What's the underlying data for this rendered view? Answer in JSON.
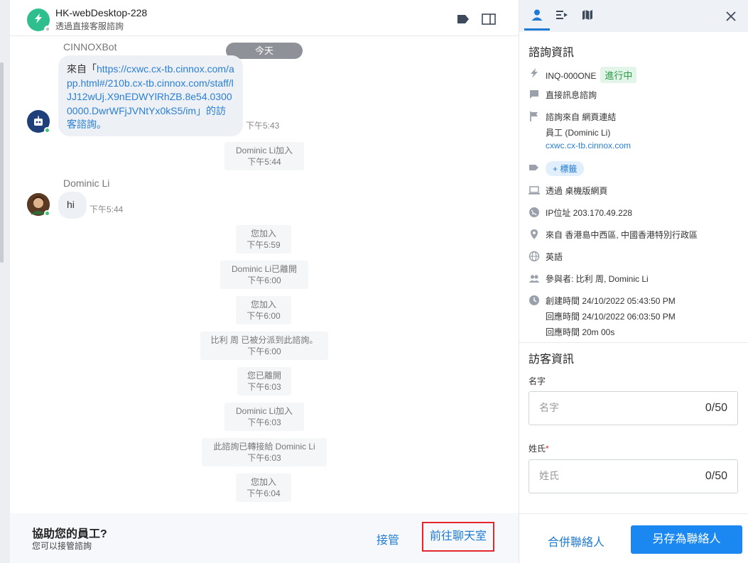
{
  "header": {
    "title": "HK-webDesktop-228",
    "subtitle": "透過直接客服諮詢"
  },
  "chat": {
    "date_pill": "今天",
    "messages": [
      {
        "sender": "CINNOXBot",
        "prefix": "來自「",
        "link": "https://cxwc.cx-tb.cinnox.com/app.html#/210b.cx-tb.cinnox.com/staff/lJJ12wUj.X9nEDWYlRhZB.8e54.03000000.DwrWFjJVNtYx0kS5/im",
        "suffix": "」的訪客諮詢。",
        "time": "下午5:43"
      },
      {
        "sender": "Dominic Li",
        "text": "hi",
        "time": "下午5:44"
      }
    ],
    "system": [
      {
        "text": "Dominic Li加入",
        "time": "下午5:44"
      },
      {
        "text": "您加入",
        "time": "下午5:59"
      },
      {
        "text": "Dominic Li已離開",
        "time": "下午6:00"
      },
      {
        "text": "您加入",
        "time": "下午6:00"
      },
      {
        "text": "比利 周 已被分派到此諮詢。",
        "time": "下午6:00"
      },
      {
        "text": "您已離開",
        "time": "下午6:03"
      },
      {
        "text": "Dominic Li加入",
        "time": "下午6:03"
      },
      {
        "text": "此諮詢已轉接給 Dominic Li",
        "time": "下午6:03"
      },
      {
        "text": "您加入",
        "time": "下午6:04"
      }
    ]
  },
  "footer": {
    "help_title": "協助您的員工?",
    "help_sub": "您可以接管諮詢",
    "takeover_label": "接管",
    "goto_room_label": "前往聊天室"
  },
  "side": {
    "inquiry_title": "諮詢資訊",
    "inquiry_id": "INQ-000ONE",
    "status": "進行中",
    "channel": "直接訊息諮詢",
    "source_line1": "諮詢來自 網頁連結",
    "source_line2": "員工 (Dominic Li)",
    "source_link": "cxwc.cx-tb.cinnox.com",
    "tag_button": "+ 標籤",
    "device": "透過 桌機版網頁",
    "ip": "IP位址 203.170.49.228",
    "location": "來自 香港島中西區, 中國香港特別行政區",
    "language": "英語",
    "participants": "參與者: 比利 周, Dominic Li",
    "created": "創建時間 24/10/2022 05:43:50 PM",
    "responded": "回應時間 24/10/2022 06:03:50 PM",
    "response_duration": "回應時間 20m 00s",
    "visitor_title": "訪客資訊",
    "first_name_label": "名字",
    "first_name_placeholder": "名字",
    "first_name_count": "0/50",
    "last_name_label": "姓氏",
    "last_name_required": "*",
    "last_name_placeholder": "姓氏",
    "last_name_count": "0/50",
    "merge_label": "合併聯絡人",
    "save_label": "另存為聯絡人"
  },
  "colors": {
    "accent": "#1f7ad1",
    "status_green": "#2a9a46",
    "highlight_red": "#e3262e",
    "primary_button": "#1a88f0"
  }
}
